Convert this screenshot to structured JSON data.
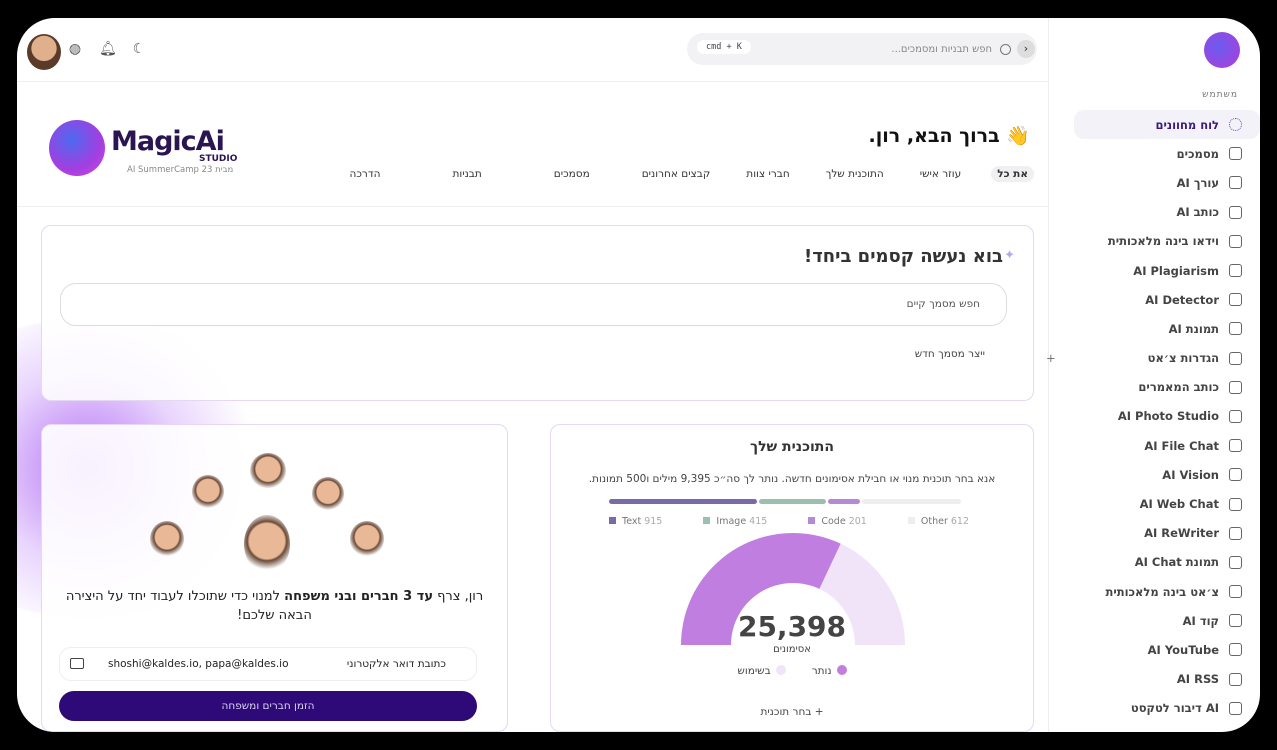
{
  "sidebar": {
    "section_label": "משתמש",
    "items": [
      {
        "label": "לוח מחוונים",
        "icon": "dashboard-icon",
        "active": true
      },
      {
        "label": "מסמכים",
        "icon": "archive-icon"
      },
      {
        "label": "עורך AI",
        "icon": "notebook-icon"
      },
      {
        "label": "כותב AI",
        "icon": "document-icon"
      },
      {
        "label": "וידאו בינה מלאכותית",
        "icon": "video-icon"
      },
      {
        "label": "AI Plagiarism",
        "icon": "check-circle-icon"
      },
      {
        "label": "AI Detector",
        "icon": "scan-icon"
      },
      {
        "label": "תמונת AI",
        "icon": "image-icon"
      },
      {
        "label": "הגדרות צ׳אט",
        "icon": "chat-bubble-icon",
        "has_plus": true
      },
      {
        "label": "כותב המאמרים",
        "icon": "article-icon"
      },
      {
        "label": "AI Photo Studio",
        "icon": "laptop-icon"
      },
      {
        "label": "AI File Chat",
        "icon": "file-edit-icon"
      },
      {
        "label": "AI Vision",
        "icon": "eye-scan-icon"
      },
      {
        "label": "AI Web Chat",
        "icon": "globe-icon"
      },
      {
        "label": "AI ReWriter",
        "icon": "pencil-icon"
      },
      {
        "label": "תמונת AI Chat",
        "icon": "image-icon"
      },
      {
        "label": "צ׳אט בינה מלאכותית",
        "icon": "message-icon"
      },
      {
        "label": "קוד AI",
        "icon": "terminal-icon"
      },
      {
        "label": "AI YouTube",
        "icon": "youtube-icon"
      },
      {
        "label": "AI RSS",
        "icon": "rss-icon"
      },
      {
        "label": "AI דיבור לטקסט",
        "icon": "microphone-icon"
      }
    ]
  },
  "topbar": {
    "search_placeholder": "חפש תבניות ומסמכים...",
    "shortcut": "cmd + K",
    "icons": [
      "globe-icon",
      "bell-icon",
      "moon-icon"
    ]
  },
  "brand": {
    "name": "MagicAi",
    "studio": "STUDIO",
    "tagline": "AI SummerCamp 23 מבית"
  },
  "header": {
    "welcome": "ברוך הבא, רון.",
    "welcome_emoji": "👋",
    "tabs": [
      "את כל",
      "עוזר אישי",
      "התוכנית שלך",
      "חברי צוות",
      "קבצים אחרונים",
      "מסמכים",
      "תבניות",
      "הדרכה"
    ]
  },
  "magic": {
    "title": "בוא נעשה קסמים ביחד!",
    "search_placeholder": "חפש מסמך קיים",
    "create_label": "ייצר מסמך חדש"
  },
  "invite": {
    "text_pre": "רון, צרף ",
    "text_bold": "עד 3 חברים ובני משפחה",
    "text_post": " למנוי כדי שתוכלו לעבוד יחד על היצירה הבאה שלכם!",
    "email_label": "כתובת דואר אלקטרוני",
    "email_value": "shoshi@kaldes.io, papa@kaldes.io",
    "button": "הזמן חברים ומשפחה"
  },
  "plan": {
    "title": "התוכנית שלך",
    "description": "אנא בחר תוכנית מנוי או חבילת אסימונים חדשה. נותר לך סה״כ 9,395 מילים ו500 תמונות.",
    "usage": [
      {
        "name": "Text",
        "value": 915,
        "color": "#7b6aa8"
      },
      {
        "name": "Image",
        "value": 415,
        "color": "#9cc0b0"
      },
      {
        "name": "Code",
        "value": 201,
        "color": "#b48ad6"
      },
      {
        "name": "Other",
        "value": 612,
        "color": "#eeeeee"
      }
    ],
    "tokens": "25,398",
    "tokens_label": "אסימונים",
    "remaining_fraction": 0.64,
    "remaining_label": "נותר",
    "used_label": "בשימוש",
    "remaining_color": "#c07fe0",
    "used_color": "#f1e4f8",
    "choose_label": "בחר תוכנית"
  }
}
